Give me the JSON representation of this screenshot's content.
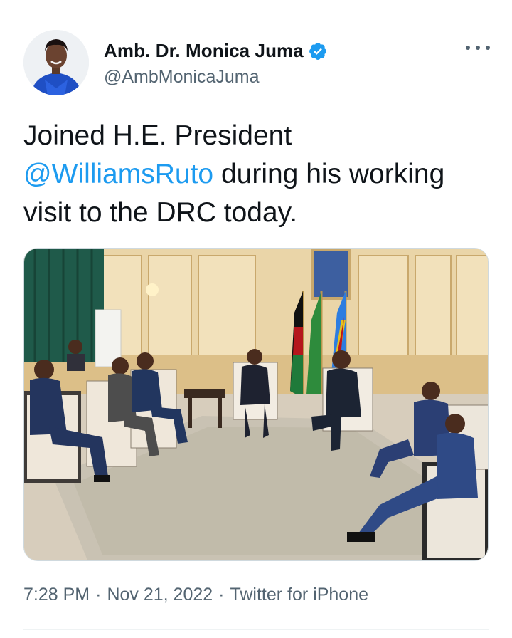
{
  "author": {
    "display_name": "Amb. Dr. Monica Juma",
    "handle": "@AmbMonicaJuma",
    "verified": true,
    "verified_icon": "verified-badge-icon",
    "verified_color": "#1d9bf0"
  },
  "tweet": {
    "text_before": "Joined H.E. President ",
    "mention": "@WilliamsRuto",
    "text_after": " during his working visit to the DRC today."
  },
  "meta": {
    "time": "7:28 PM",
    "sep1": "·",
    "date": "Nov 21, 2022",
    "sep2": "·",
    "source": "Twitter for iPhone"
  },
  "colors": {
    "link": "#1d9bf0",
    "secondary_text": "#536471",
    "primary_text": "#0f1419"
  },
  "icons": {
    "more": "more-options-icon"
  }
}
